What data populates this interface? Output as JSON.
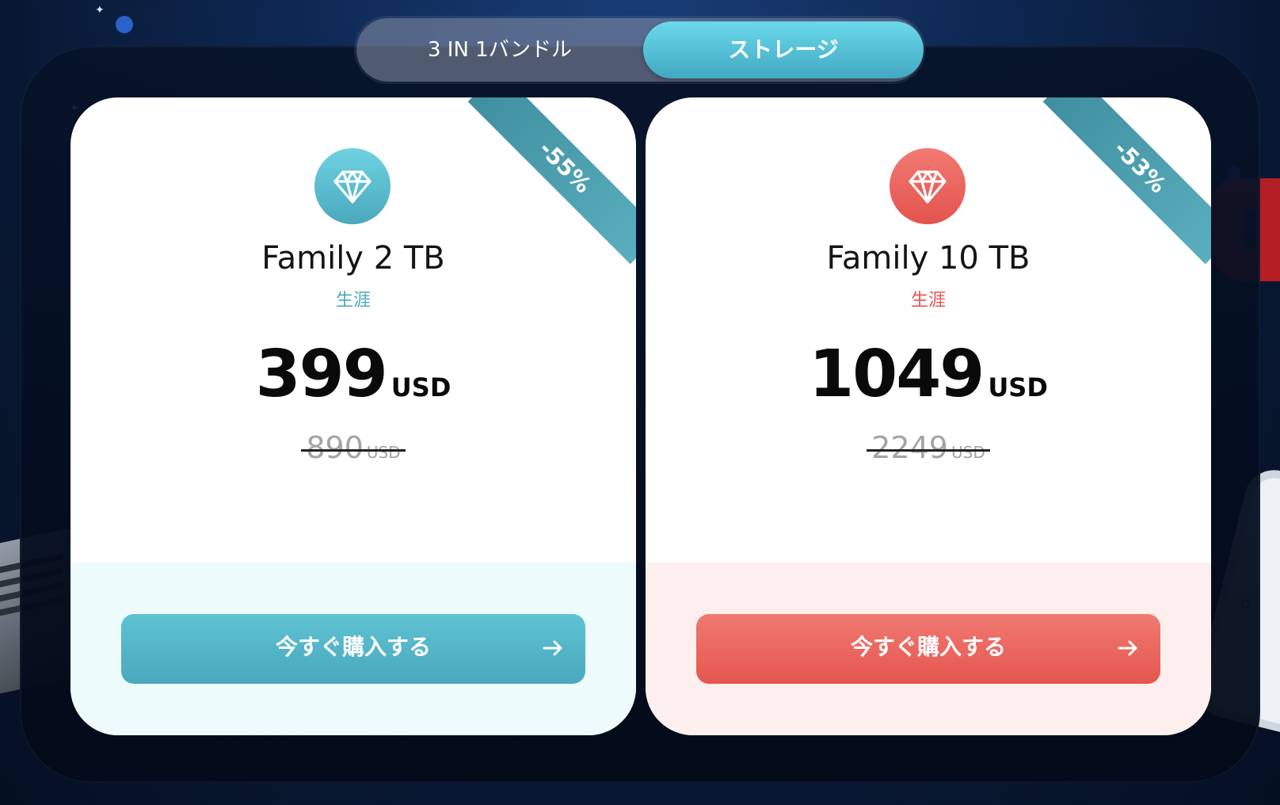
{
  "tabs": {
    "bundle": "3 IN 1バンドル",
    "storage": "ストレージ",
    "active": "storage"
  },
  "plans": [
    {
      "discount": "-55%",
      "name": "Family 2 TB",
      "term": "生涯",
      "price": "399",
      "currency": "USD",
      "original_price": "890",
      "original_currency": "USD",
      "buy_label": "今すぐ購入する",
      "icon": "diamond-icon",
      "accent": "#4aa8bd"
    },
    {
      "discount": "-53%",
      "name": "Family 10 TB",
      "term": "生涯",
      "price": "1049",
      "currency": "USD",
      "original_price": "2249",
      "original_currency": "USD",
      "buy_label": "今すぐ購入する",
      "icon": "diamond-icon",
      "accent": "#e4534d"
    }
  ],
  "colors": {
    "background": "#0f2a56",
    "teal_accent": "#4aa8bd",
    "red_accent": "#e4534d"
  }
}
